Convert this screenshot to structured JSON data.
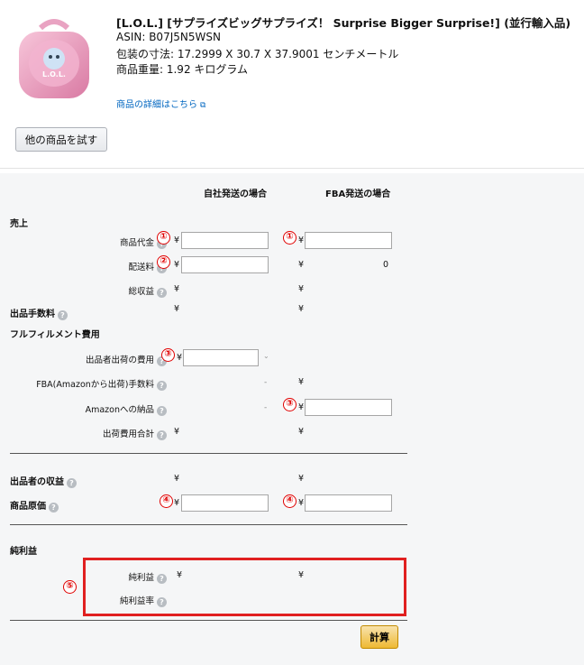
{
  "product": {
    "title": "[L.O.L.] [サプライズビッグサプライズ！ Surprise Bigger Surprise!] (並行輸入品)",
    "asin": "ASIN: B07J5N5WSN",
    "dimensions": "包装の寸法: 17.2999 X 30.7 X 37.9001 センチメートル",
    "weight": "商品重量: 1.92 キログラム",
    "detail_link": "商品の詳細はこちら",
    "try_other_button": "他の商品を試す"
  },
  "calculator": {
    "col_self": "自社発送の場合",
    "col_fba": "FBA発送の場合",
    "section_revenue": "売上",
    "price_label": "商品代金",
    "shipping_label": "配送料",
    "total_revenue_label": "総収益",
    "selling_fee_label": "出品手数料",
    "section_fulfillment": "フルフィルメント費用",
    "seller_shipping_label": "出品者出荷の費用",
    "fba_fee_label": "FBA(Amazonから出荷)手数料",
    "amazon_inbound_label": "Amazonへの納品",
    "shipping_total_label": "出荷費用合計",
    "seller_proceeds_label": "出品者の収益",
    "cost_label": "商品原価",
    "section_net": "純利益",
    "net_profit_label": "純利益",
    "net_margin_label": "純利益率",
    "yen": "¥",
    "fba_shipping_value": "0",
    "dash": "-",
    "calc_button": "計算"
  },
  "markers": {
    "m1": "①",
    "m2": "②",
    "m3": "③",
    "m4": "④",
    "m5": "⑤"
  },
  "help_icon": "?",
  "external_icon": "⧉"
}
